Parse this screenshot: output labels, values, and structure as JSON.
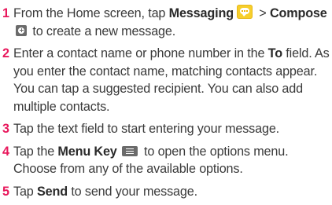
{
  "colors": {
    "accent": "#e8185c",
    "text": "#3a3a3a",
    "messaging_icon": "#f7cf2c",
    "key_icon": "#6b6b6b"
  },
  "icons": {
    "messaging": "messaging-app-icon",
    "compose": "compose-icon",
    "menu_key": "menu-key-icon"
  },
  "steps": [
    {
      "number": "1",
      "parts": {
        "t1": "From the Home screen, tap ",
        "b1": "Messaging",
        "t2": " > ",
        "b2": "Compose",
        "t3": " to create a new message."
      }
    },
    {
      "number": "2",
      "parts": {
        "t1": "Enter a contact name or phone number in the ",
        "b1": "To",
        "t2": " field. As you enter the contact name, matching contacts appear. You can tap a suggested recipient. You can also add multiple contacts."
      }
    },
    {
      "number": "3",
      "parts": {
        "t1": "Tap the text field to start entering your message."
      }
    },
    {
      "number": "4",
      "parts": {
        "t1": "Tap the ",
        "b1": "Menu Key",
        "t2": " to open the options menu. Choose from any of the available options."
      }
    },
    {
      "number": "5",
      "parts": {
        "t1": "Tap ",
        "b1": "Send",
        "t2": " to send your message."
      }
    }
  ]
}
